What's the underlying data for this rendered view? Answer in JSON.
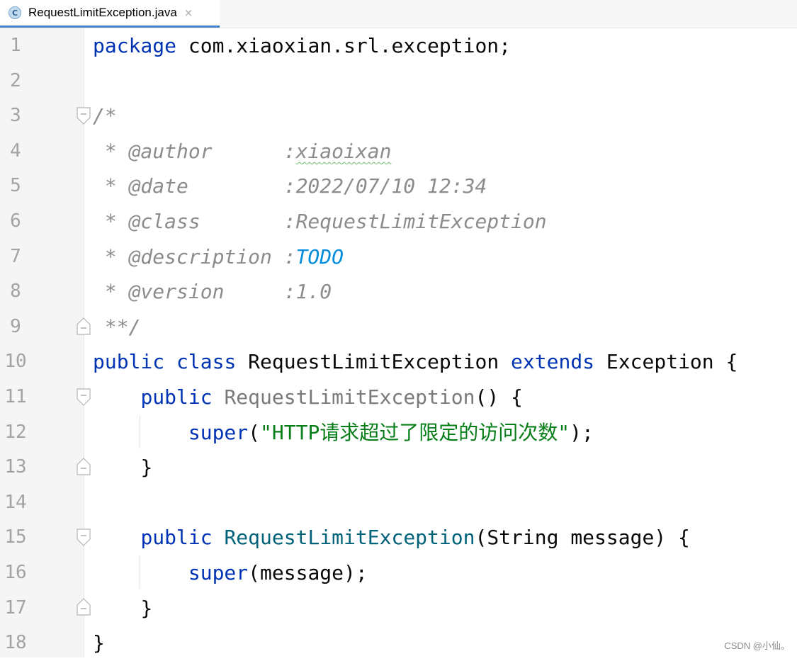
{
  "tab": {
    "icon_letter": "C",
    "title": "RequestLimitException.java",
    "close": "×"
  },
  "line_numbers": [
    "1",
    "2",
    "3",
    "4",
    "5",
    "6",
    "7",
    "8",
    "9",
    "10",
    "11",
    "12",
    "13",
    "14",
    "15",
    "16",
    "17",
    "18"
  ],
  "code": {
    "l1_kw": "package",
    "l1_rest": " com.xiaoxian.srl.exception;",
    "l3": "/*",
    "l4_a": " * @author      :",
    "l4_b": "xiaoixan",
    "l5": " * @date        :2022/07/10 12:34",
    "l6": " * @class       :RequestLimitException",
    "l7_a": " * @description :",
    "l7_b": "TODO",
    "l8": " * @version     :1.0",
    "l9": " **/",
    "l10_kw1": "public",
    "l10_kw2": "class",
    "l10_name": "RequestLimitException",
    "l10_kw3": "extends",
    "l10_rest": "Exception {",
    "l11_kw": "public",
    "l11_name": "RequestLimitException",
    "l11_rest": "() {",
    "l12_kw": "super",
    "l12_open": "(",
    "l12_str": "\"HTTP请求超过了限定的访问次数\"",
    "l12_close": ");",
    "l13": "}",
    "l15_kw": "public",
    "l15_name": "RequestLimitException",
    "l15_rest": "(String message) {",
    "l16_kw": "super",
    "l16_rest": "(message);",
    "l17": "}",
    "l18": "}"
  },
  "watermark": "CSDN @小仙。",
  "colors": {
    "keyword": "#0033b3",
    "comment": "#8c8c8c",
    "todo": "#008dde",
    "string": "#067d17",
    "method": "#00627a",
    "tab_underline": "#4083c9"
  }
}
